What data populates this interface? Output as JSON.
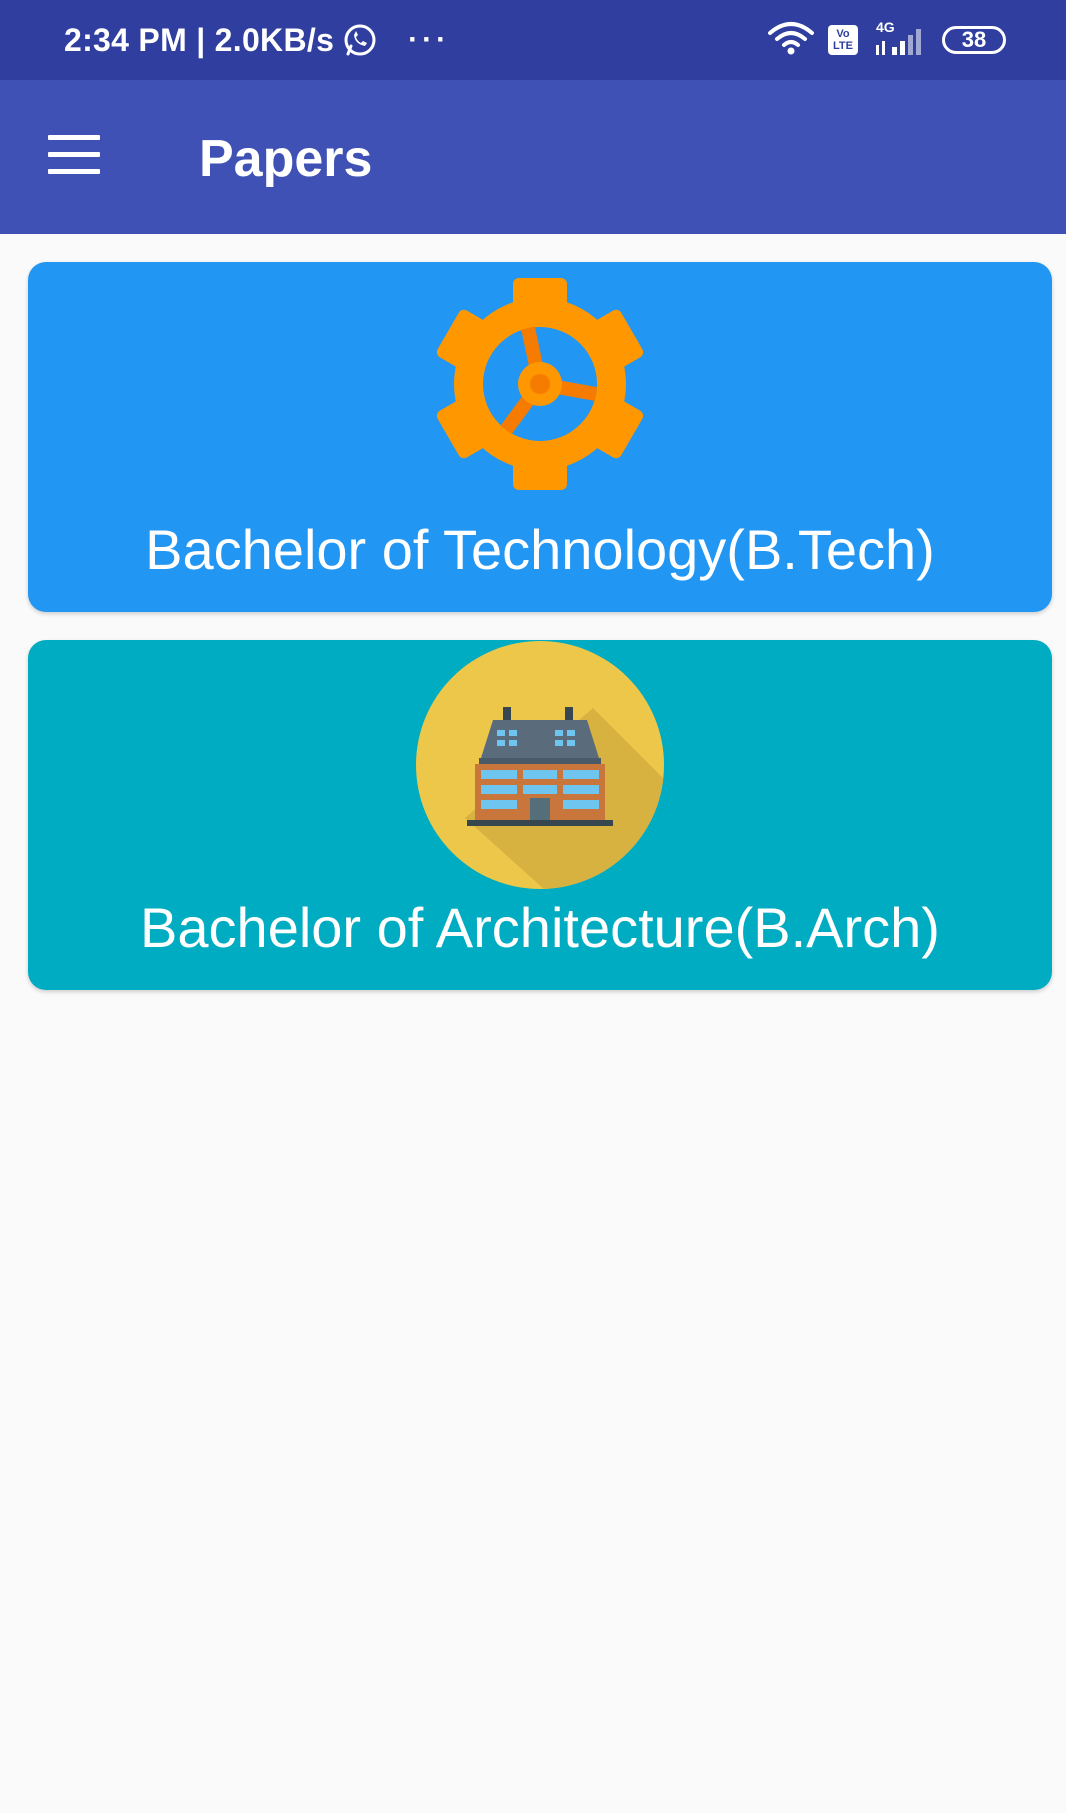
{
  "status_bar": {
    "time_speed": "2:34 PM | 2.0KB/s",
    "overflow_dots": "···",
    "volte_line1": "Vo",
    "volte_line2": "LTE",
    "network": "4G",
    "battery": "38"
  },
  "app_bar": {
    "title": "Papers"
  },
  "cards": [
    {
      "label": "Bachelor of Technology(B.Tech)",
      "icon": "gear-icon",
      "color": "#2196f3"
    },
    {
      "label": "Bachelor of Architecture(B.Arch)",
      "icon": "building-icon",
      "color": "#00acc1"
    }
  ],
  "colors": {
    "status_bar": "#303f9f",
    "app_bar": "#3f51b5",
    "background": "#fafafa"
  }
}
